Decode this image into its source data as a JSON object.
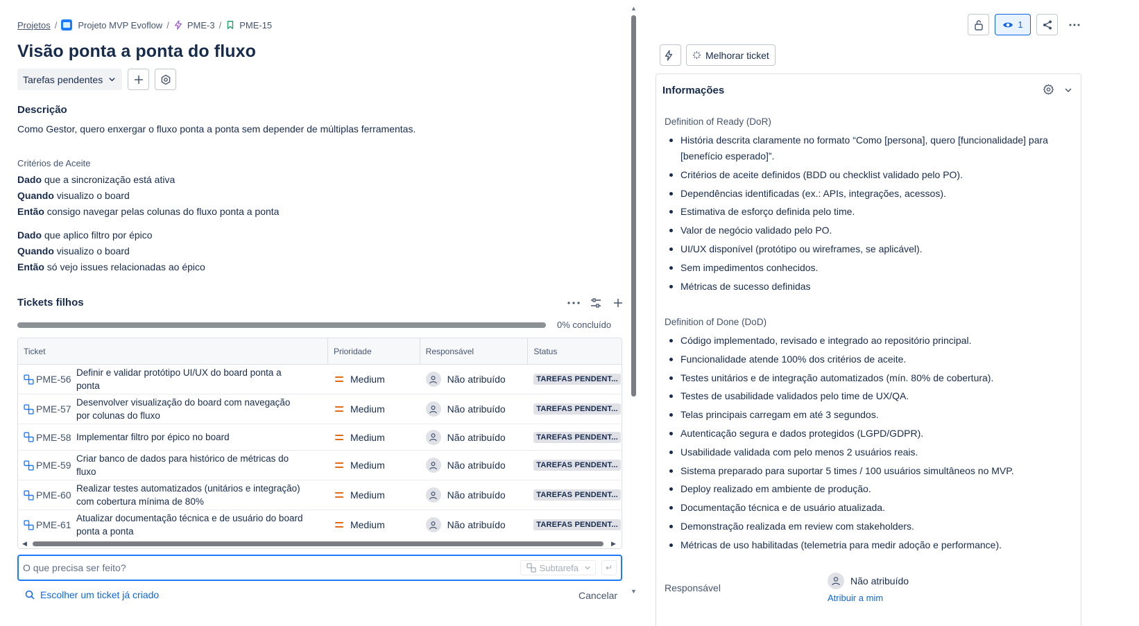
{
  "breadcrumb": {
    "projects": "Projetos",
    "project": "Projeto MVP Evoflow",
    "epic": "PME-3",
    "story": "PME-15"
  },
  "title": "Visão ponta a ponta do fluxo",
  "status": {
    "label": "Tarefas pendentes"
  },
  "description": {
    "heading": "Descrição",
    "text": "Como Gestor, quero enxergar o fluxo ponta a ponta sem depender de múltiplas ferramentas.",
    "criteria_heading": "Critérios de Aceite",
    "scenarios": [
      [
        {
          "kw": "Dado",
          "rest": " que a sincronização está ativa"
        },
        {
          "kw": "Quando",
          "rest": " visualizo o board"
        },
        {
          "kw": "Então",
          "rest": " consigo navegar pelas colunas do fluxo ponta a ponta"
        }
      ],
      [
        {
          "kw": "Dado",
          "rest": " que aplico filtro por épico"
        },
        {
          "kw": "Quando",
          "rest": " visualizo o board"
        },
        {
          "kw": "Então",
          "rest": " só vejo issues relacionadas ao épico"
        }
      ]
    ]
  },
  "children": {
    "heading": "Tickets filhos",
    "progress_fraction": 0,
    "progress_label": "0% concluído",
    "columns": [
      "Ticket",
      "Prioridade",
      "Responsável",
      "Status"
    ],
    "rows": [
      {
        "key": "PME-56",
        "summary": "Definir e validar protótipo UI/UX do board ponta a ponta",
        "priority": "Medium",
        "assignee": "Não atribuído",
        "status": "TAREFAS PENDENT..."
      },
      {
        "key": "PME-57",
        "summary": "Desenvolver visualização do board com navegação por colunas do fluxo",
        "priority": "Medium",
        "assignee": "Não atribuído",
        "status": "TAREFAS PENDENT..."
      },
      {
        "key": "PME-58",
        "summary": "Implementar filtro por épico no board",
        "priority": "Medium",
        "assignee": "Não atribuído",
        "status": "TAREFAS PENDENT..."
      },
      {
        "key": "PME-59",
        "summary": "Criar banco de dados para histórico de métricas do fluxo",
        "priority": "Medium",
        "assignee": "Não atribuído",
        "status": "TAREFAS PENDENT..."
      },
      {
        "key": "PME-60",
        "summary": "Realizar testes automatizados (unitários e integração) com cobertura mínima de 80%",
        "priority": "Medium",
        "assignee": "Não atribuído",
        "status": "TAREFAS PENDENT..."
      },
      {
        "key": "PME-61",
        "summary": "Atualizar documentação técnica e de usuário do board ponta a ponta",
        "priority": "Medium",
        "assignee": "Não atribuído",
        "status": "TAREFAS PENDENT..."
      }
    ],
    "new_placeholder": "O que precisa ser feito?",
    "type_select": "Subtarefa",
    "choose_existing": "Escolher um ticket já criado",
    "cancel": "Cancelar"
  },
  "top_actions": {
    "watchers": "1"
  },
  "ai": {
    "improve": "Melhorar ticket"
  },
  "info": {
    "heading": "Informações",
    "dor_heading": "Definition of Ready (DoR)",
    "dor": [
      "História descrita claramente no formato “Como [persona], quero [funcionalidade] para [benefício esperado]”.",
      "Critérios de aceite definidos (BDD ou checklist validado pelo PO).",
      "Dependências identificadas (ex.: APIs, integrações, acessos).",
      "Estimativa de esforço definida pelo time.",
      "Valor de negócio validado pelo PO.",
      "UI/UX disponível (protótipo ou wireframes, se aplicável).",
      "Sem impedimentos conhecidos.",
      "Métricas de sucesso definidas"
    ],
    "dod_heading": "Definition of Done (DoD)",
    "dod": [
      "Código implementado, revisado e integrado ao repositório principal.",
      "Funcionalidade atende 100% dos critérios de aceite.",
      "Testes unitários e de integração automatizados (mín. 80% de cobertura).",
      "Testes de usabilidade validados pelo time de UX/QA.",
      "Telas principais carregam em até 3 segundos.",
      "Autenticação segura e dados protegidos (LGPD/GDPR).",
      "Usabilidade validada com pelo menos 2 usuários reais.",
      "Sistema preparado para suportar 5 times / 100 usuários simultâneos no MVP.",
      "Deploy realizado em ambiente de produção.",
      "Documentação técnica e de usuário atualizada.",
      "Demonstração realizada em review com stakeholders.",
      "Métricas de uso habilitadas (telemetria para medir adoção e performance)."
    ],
    "assignee_label": "Responsável",
    "assignee_value": "Não atribuído",
    "assign_me": "Atribuir a mim"
  },
  "colors": {
    "accent": "#0c66e4",
    "priority_medium": "#e56910",
    "lozenge_bg": "#dfe1e6"
  }
}
